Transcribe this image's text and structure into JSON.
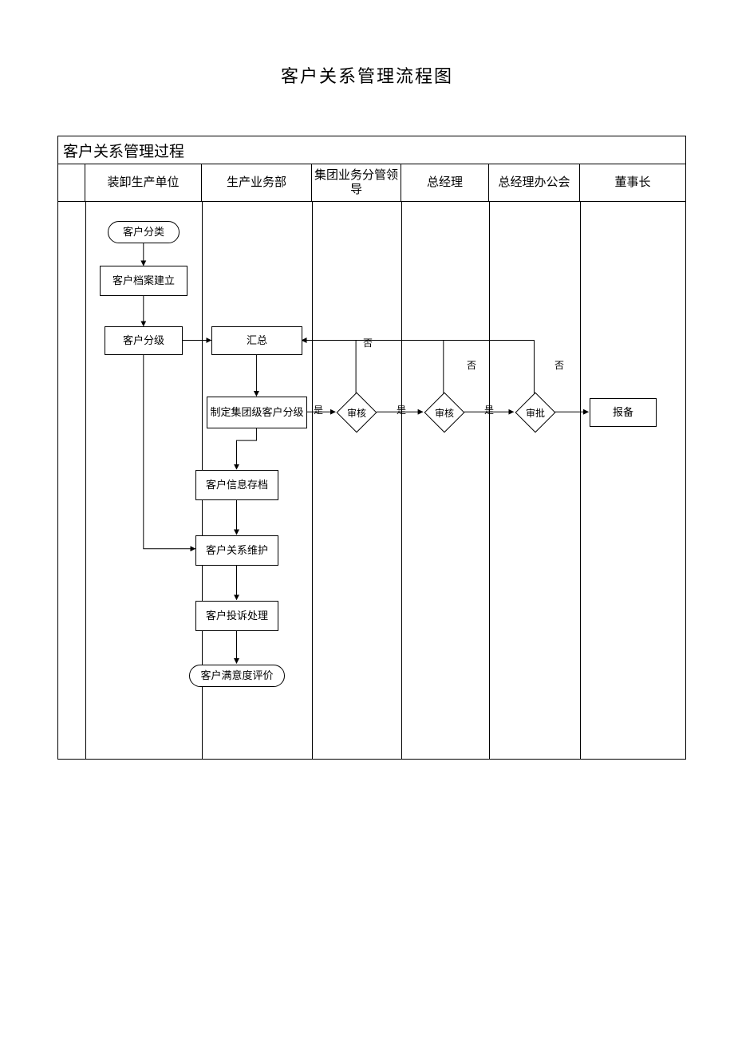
{
  "title": "客户关系管理流程图",
  "section_title": "客户关系管理过程",
  "lanes": {
    "l1": "装卸生产单位",
    "l2": "生产业务部",
    "l3": "集团业务分管领导",
    "l4": "总经理",
    "l5": "总经理办公会",
    "l6": "董事长"
  },
  "nodes": {
    "start": "客户分类",
    "n2": "客户档案建立",
    "n3": "客户分级",
    "n4": "汇总",
    "n5": "制定集团级客户分级",
    "n6": "客户信息存档",
    "n7": "客户关系维护",
    "n8": "客户投诉处理",
    "end": "客户满意度评价",
    "d1": "审核",
    "d2": "审核",
    "d3": "审批",
    "n9": "报备"
  },
  "labels": {
    "yes": "是",
    "no": "否"
  },
  "chart_data": {
    "type": "flowchart-swimlane",
    "lanes": [
      {
        "id": "L1",
        "name": "装卸生产单位"
      },
      {
        "id": "L2",
        "name": "生产业务部"
      },
      {
        "id": "L3",
        "name": "集团业务分管领导"
      },
      {
        "id": "L4",
        "name": "总经理"
      },
      {
        "id": "L5",
        "name": "总经理办公会"
      },
      {
        "id": "L6",
        "name": "董事长"
      }
    ],
    "nodes": [
      {
        "id": "start",
        "lane": "L1",
        "shape": "terminator",
        "label": "客户分类"
      },
      {
        "id": "n2",
        "lane": "L1",
        "shape": "process",
        "label": "客户档案建立"
      },
      {
        "id": "n3",
        "lane": "L1",
        "shape": "process",
        "label": "客户分级"
      },
      {
        "id": "n4",
        "lane": "L2",
        "shape": "process",
        "label": "汇总"
      },
      {
        "id": "n5",
        "lane": "L2",
        "shape": "process",
        "label": "制定集团级客户分级"
      },
      {
        "id": "d1",
        "lane": "L3",
        "shape": "decision",
        "label": "审核"
      },
      {
        "id": "d2",
        "lane": "L4",
        "shape": "decision",
        "label": "审核"
      },
      {
        "id": "d3",
        "lane": "L5",
        "shape": "decision",
        "label": "审批"
      },
      {
        "id": "n9",
        "lane": "L6",
        "shape": "process",
        "label": "报备"
      },
      {
        "id": "n6",
        "lane": "L2",
        "shape": "process",
        "label": "客户信息存档"
      },
      {
        "id": "n7",
        "lane": "L2",
        "shape": "process",
        "label": "客户关系维护"
      },
      {
        "id": "n8",
        "lane": "L2",
        "shape": "process",
        "label": "客户投诉处理"
      },
      {
        "id": "end",
        "lane": "L2",
        "shape": "terminator",
        "label": "客户满意度评价"
      }
    ],
    "edges": [
      {
        "from": "start",
        "to": "n2"
      },
      {
        "from": "n2",
        "to": "n3"
      },
      {
        "from": "n3",
        "to": "n4"
      },
      {
        "from": "n3",
        "to": "n7",
        "note": "直下后右转"
      },
      {
        "from": "n4",
        "to": "n5"
      },
      {
        "from": "n5",
        "to": "d1",
        "label": "是"
      },
      {
        "from": "d1",
        "to": "d2",
        "label": "是"
      },
      {
        "from": "d2",
        "to": "d3",
        "label": "是"
      },
      {
        "from": "d3",
        "to": "n9"
      },
      {
        "from": "d1",
        "to": "n4",
        "label": "否"
      },
      {
        "from": "d2",
        "to": "n4",
        "label": "否"
      },
      {
        "from": "d3",
        "to": "n4",
        "label": "否"
      },
      {
        "from": "n5",
        "to": "n6"
      },
      {
        "from": "n6",
        "to": "n7"
      },
      {
        "from": "n7",
        "to": "n8"
      },
      {
        "from": "n8",
        "to": "end"
      }
    ]
  }
}
